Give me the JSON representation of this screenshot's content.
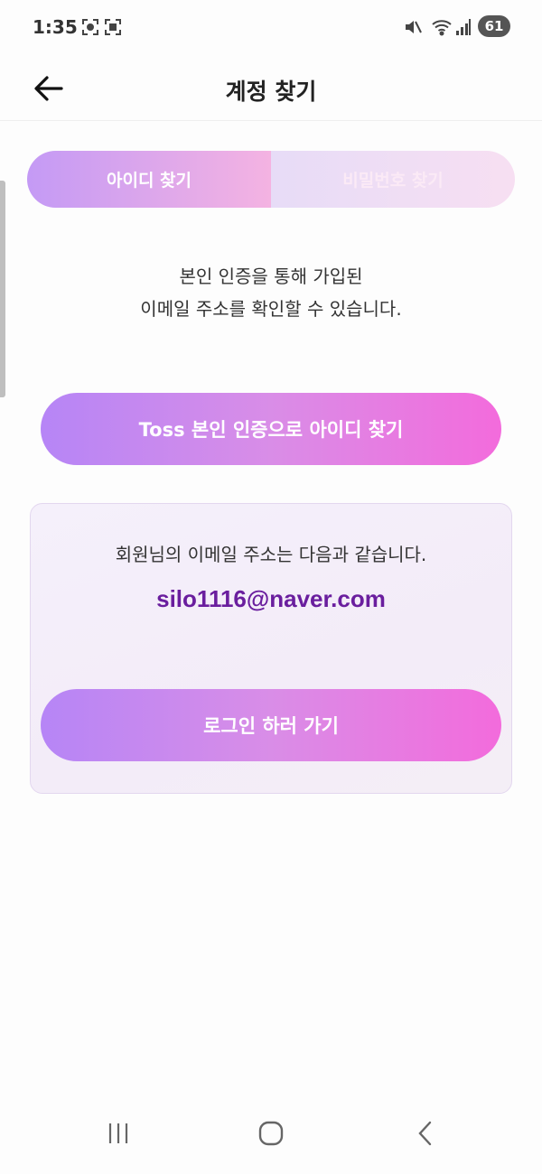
{
  "status_bar": {
    "time": "1:35",
    "battery": "61"
  },
  "header": {
    "title": "계정 찾기"
  },
  "tabs": [
    {
      "label": "아이디 찾기",
      "active": true
    },
    {
      "label": "비밀번호 찾기",
      "active": false
    }
  ],
  "description": {
    "line1": "본인 인증을 통해 가입된",
    "line2": "이메일 주소를 확인할 수 있습니다."
  },
  "toss_button": {
    "label": "Toss 본인 인증으로 아이디 찾기"
  },
  "result": {
    "message": "회원님의 이메일 주소는 다음과 같습니다.",
    "email": "silo1116@naver.com",
    "login_button": "로그인 하러 가기"
  },
  "colors": {
    "accent_purple": "#b685f6",
    "accent_pink": "#f36bdc",
    "email_text": "#6a1e9e"
  }
}
